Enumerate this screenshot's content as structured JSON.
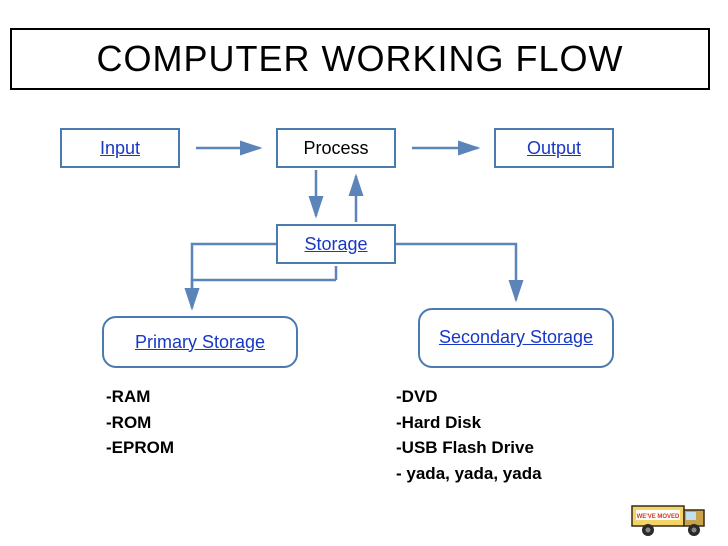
{
  "title": "COMPUTER WORKING FLOW",
  "nodes": {
    "input": "Input",
    "process": "Process",
    "output": "Output",
    "storage": "Storage",
    "primary": "Primary Storage",
    "secondary": "Secondary Storage"
  },
  "primary_list": [
    "RAM",
    "ROM",
    "EPROM"
  ],
  "secondary_list": [
    "DVD",
    "Hard Disk",
    "USB Flash Drive",
    " yada, yada, yada"
  ],
  "truck_label": "WE'VE MOVED"
}
